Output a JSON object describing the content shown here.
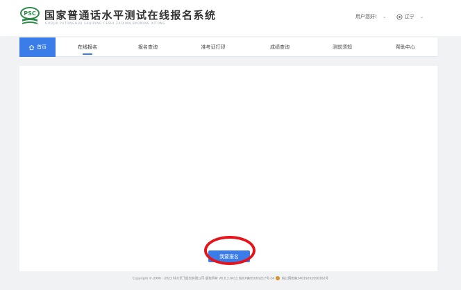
{
  "header": {
    "logo_text": "PSC",
    "title": "国家普通话水平测试在线报名系统",
    "subtitle": "GUOJIA PUTONGHUA SHUIPING CESHI ZAIXIAN BAOMING XITONG",
    "greeting": "用户您好!",
    "region": "辽宁"
  },
  "nav": {
    "home": "首页",
    "items": [
      "在线报名",
      "报名查询",
      "准考证打印",
      "成绩查询",
      "测前须知",
      "帮助中心"
    ],
    "active_index": 0
  },
  "main": {
    "apply_button": "我要报名"
  },
  "footer": {
    "text_left": "Copyright © 2006 - 2023 科大讯飞股份有限公司 版权所有 V6.6.3.0411 皖ICP备05001217号-24",
    "text_right": "皖公网安备34019202000162号"
  },
  "colors": {
    "accent": "#3a7ce8",
    "highlight": "#e5141a",
    "logo_green": "#2e8b4a"
  }
}
